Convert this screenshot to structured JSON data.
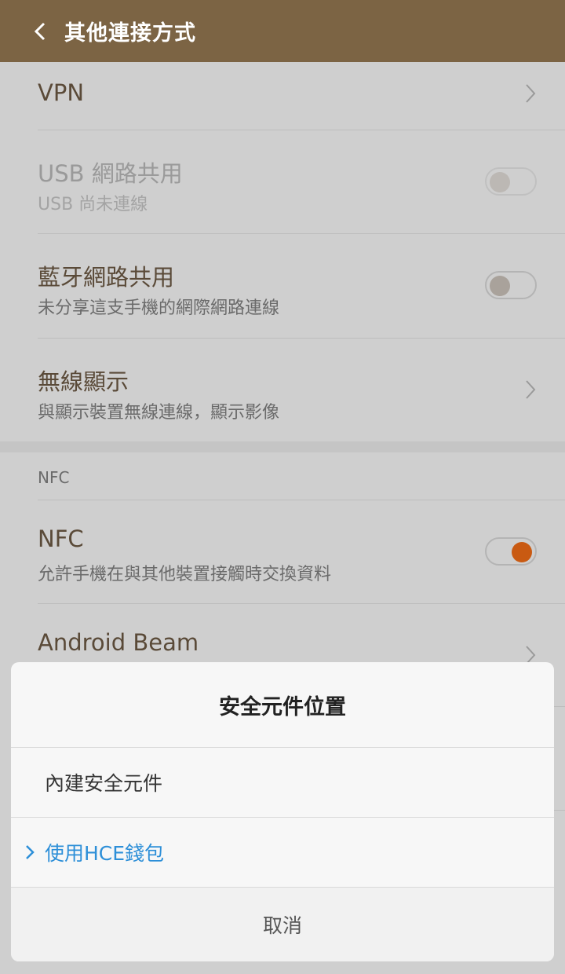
{
  "header": {
    "title": "其他連接方式"
  },
  "settings": {
    "vpn": {
      "label": "VPN"
    },
    "usb": {
      "label": "USB 網路共用",
      "sub": "USB 尚未連線"
    },
    "bt": {
      "label": "藍牙網路共用",
      "sub": "未分享這支手機的網際網路連線"
    },
    "wireless": {
      "label": "無線顯示",
      "sub": "與顯示裝置無線連線，顯示影像"
    },
    "nfc_section": "NFC",
    "nfc": {
      "label": "NFC",
      "sub": "允許手機在與其他裝置接觸時交換資料"
    },
    "beam": {
      "label": "Android Beam"
    }
  },
  "dialog": {
    "title": "安全元件位置",
    "options": [
      {
        "label": "內建安全元件",
        "selected": false
      },
      {
        "label": "使用HCE錢包",
        "selected": true
      }
    ],
    "cancel": "取消"
  },
  "colors": {
    "header": "#7c6444",
    "accent_toggle": "#c95a12",
    "selected_option": "#2d8fd8"
  }
}
